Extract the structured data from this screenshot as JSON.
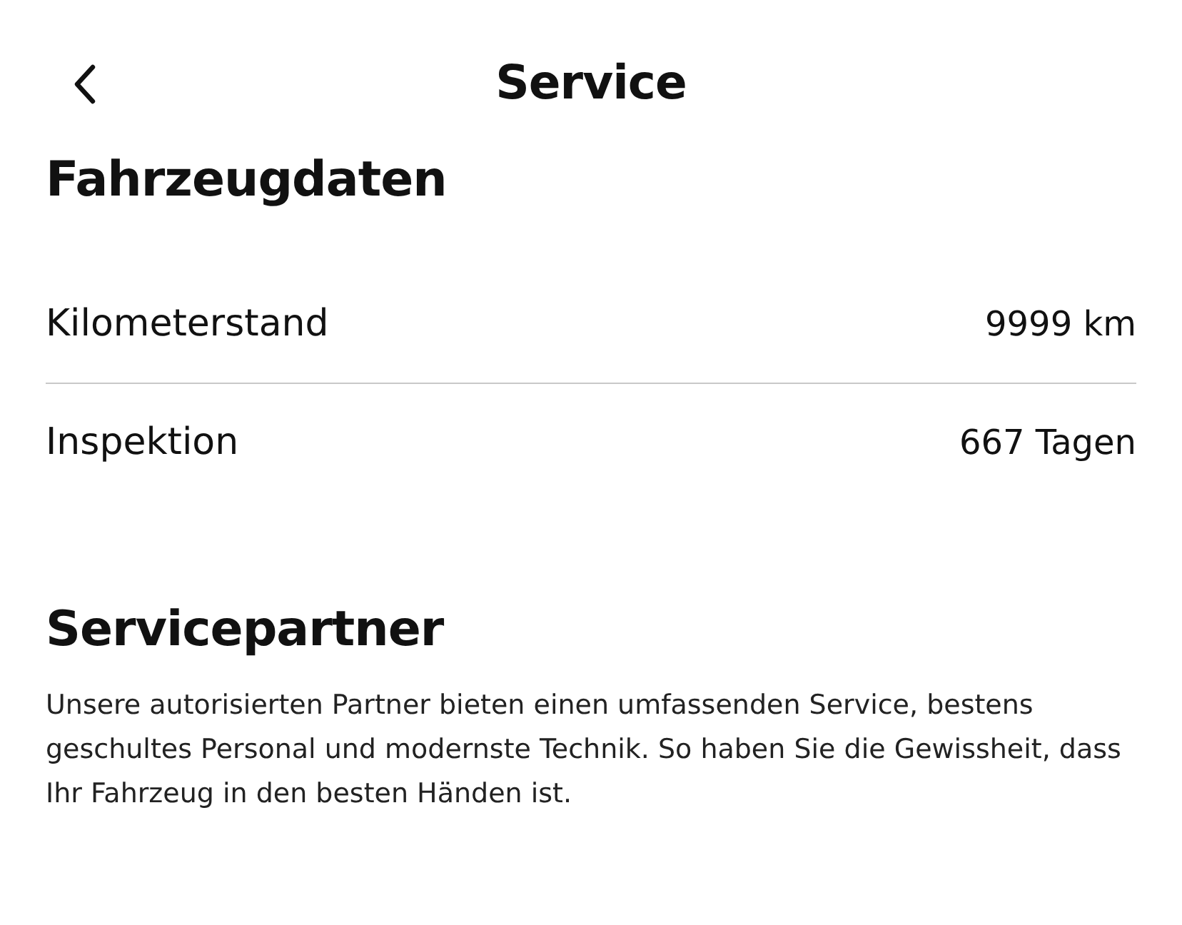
{
  "header": {
    "title": "Service"
  },
  "vehicle_data": {
    "heading": "Fahrzeugdaten",
    "rows": [
      {
        "label": "Kilometerstand",
        "value": "9999 km"
      },
      {
        "label": "Inspektion",
        "value": "667 Tagen"
      }
    ]
  },
  "service_partner": {
    "heading": "Servicepartner",
    "description": "Unsere autorisierten Partner bieten einen umfassenden Service, bestens geschultes Personal und modernste Technik. So haben Sie die Gewissheit, dass Ihr Fahrzeug in den besten Händen ist."
  }
}
